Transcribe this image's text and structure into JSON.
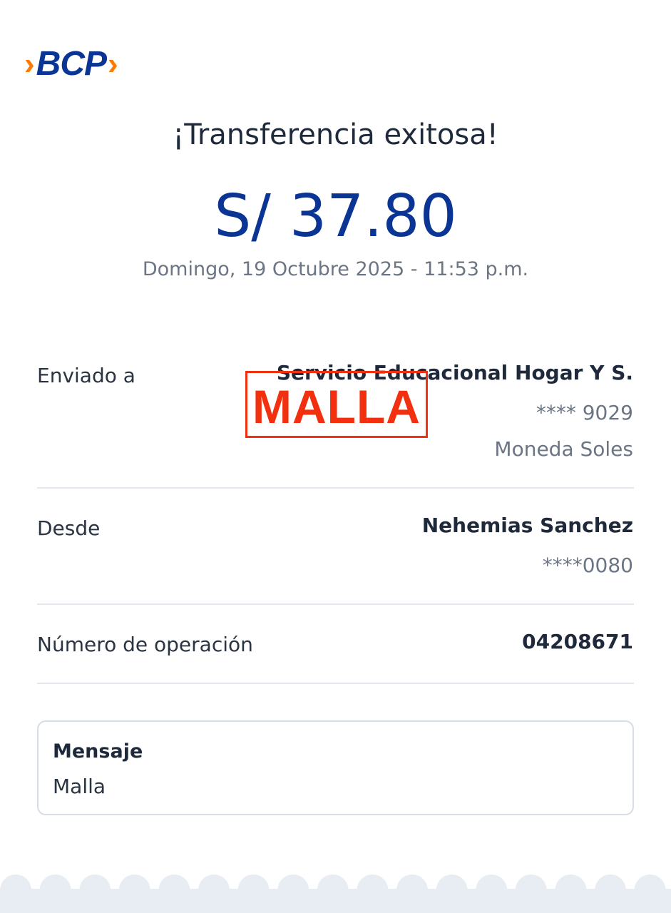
{
  "brand": {
    "logo_text": "BCP",
    "logo_colors": {
      "blue": "#0a3594",
      "orange": "#ff7a00"
    }
  },
  "receipt": {
    "title": "¡Transferencia exitosa!",
    "amount": "S/ 37.80",
    "datetime": "Domingo, 19 Octubre 2025 - 11:53 p.m."
  },
  "sent_to": {
    "label": "Enviado a",
    "name": "Servicio Educacional Hogar Y S.",
    "account": "**** 9029",
    "currency": "Moneda Soles"
  },
  "from": {
    "label": "Desde",
    "name": "Nehemias Sanchez",
    "account": "****0080"
  },
  "operation": {
    "label": "Número de operación",
    "number": "04208671"
  },
  "message": {
    "title": "Mensaje",
    "text": "Malla"
  },
  "stamp": {
    "text": "MALLA",
    "color": "#f2300f"
  },
  "colors": {
    "amount": "#0a3594",
    "footer": "#e8edf3"
  }
}
